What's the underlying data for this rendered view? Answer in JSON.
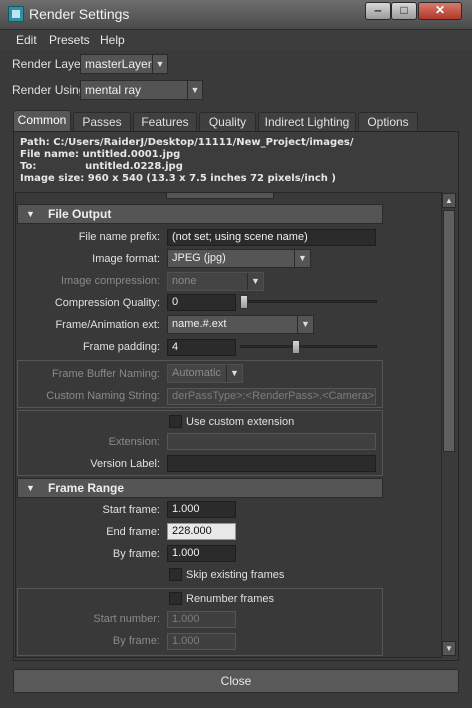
{
  "window": {
    "title": "Render Settings",
    "minimize": "‒",
    "maximize": "□",
    "close": "✕"
  },
  "menu": [
    "Edit",
    "Presets",
    "Help"
  ],
  "render_layer": {
    "label": "Render Layer",
    "value": "masterLayer"
  },
  "render_using": {
    "label": "Render Using",
    "value": "mental ray"
  },
  "tabs": [
    "Common",
    "Passes",
    "Features",
    "Quality",
    "Indirect Lighting",
    "Options"
  ],
  "info": {
    "path": "Path: C:/Users/RaiderJ/Desktop/11111/New_Project/images/",
    "file_name": "File name:  untitled.0001.jpg",
    "to": "To:              untitled.0228.jpg",
    "image_size": "Image size: 960 x 540 (13.3 x 7.5 inches 72 pixels/inch )"
  },
  "file_output": {
    "header": "File Output",
    "file_name_prefix": {
      "label": "File name prefix:",
      "value": "(not set; using scene name)"
    },
    "image_format": {
      "label": "Image format:",
      "value": "JPEG (jpg)"
    },
    "image_compression": {
      "label": "Image compression:",
      "value": "none"
    },
    "compression_quality": {
      "label": "Compression Quality:",
      "value": "0",
      "slider": 0.0
    },
    "frame_ext": {
      "label": "Frame/Animation ext:",
      "value": "name.#.ext"
    },
    "frame_padding": {
      "label": "Frame padding:",
      "value": "4",
      "slider": 0.4
    },
    "frame_buffer_naming": {
      "label": "Frame Buffer Naming:",
      "value": "Automatic"
    },
    "custom_naming": {
      "label": "Custom Naming String:",
      "value": "derPassType>:<RenderPass>.<Camera>"
    },
    "use_custom_ext": "Use custom extension",
    "extension": {
      "label": "Extension:",
      "value": ""
    },
    "version_label": {
      "label": "Version Label:",
      "value": ""
    }
  },
  "frame_range": {
    "header": "Frame Range",
    "start_frame": {
      "label": "Start frame:",
      "value": "1.000"
    },
    "end_frame": {
      "label": "End frame:",
      "value": "228.000"
    },
    "by_frame": {
      "label": "By frame:",
      "value": "1.000"
    },
    "skip_existing": "Skip existing frames",
    "renumber": "Renumber frames",
    "start_number": {
      "label": "Start number:",
      "value": "1.000"
    },
    "by_frame_2": {
      "label": "By frame:",
      "value": "1.000"
    }
  },
  "close_button": "Close"
}
